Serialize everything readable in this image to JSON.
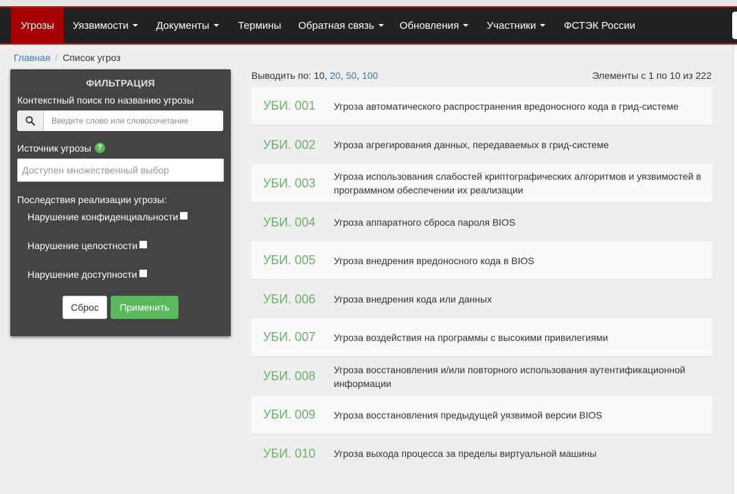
{
  "nav": {
    "items": [
      {
        "label": "Угрозы",
        "dropdown": false,
        "active": true
      },
      {
        "label": "Уязвимости",
        "dropdown": true
      },
      {
        "label": "Документы",
        "dropdown": true
      },
      {
        "label": "Термины",
        "dropdown": false
      },
      {
        "label": "Обратная связь",
        "dropdown": true
      },
      {
        "label": "Обновления",
        "dropdown": true
      },
      {
        "label": "Участники",
        "dropdown": true
      },
      {
        "label": "ФСТЭК России",
        "dropdown": false
      }
    ],
    "colors": {
      "background": "#222222",
      "active": "#a40000",
      "accent_border": "#b51c1c"
    }
  },
  "breadcrumb": {
    "home": "Главная",
    "separator": "/",
    "current": "Список угроз"
  },
  "filter": {
    "title": "ФИЛЬТРАЦИЯ",
    "search_label": "Контекстный поиск по названию угрозы",
    "search_placeholder": "Введите слово или словосочетание",
    "search_icon": "search-icon",
    "source_label": "Источник угрозы",
    "source_help_icon": "?",
    "source_placeholder": "Доступен множественный выбор",
    "consequences_label": "Последствия реализации угрозы:",
    "checkboxes": [
      {
        "label": "Нарушение конфиденциальности",
        "checked": false
      },
      {
        "label": "Нарушение целостности",
        "checked": false
      },
      {
        "label": "Нарушение доступности",
        "checked": false
      }
    ],
    "reset_label": "Сброс",
    "apply_label": "Применить",
    "colors": {
      "panel": "#444444",
      "apply": "#5cb85c"
    }
  },
  "pagination": {
    "label": "Выводить по:",
    "current": "10",
    "options": [
      "20",
      "50",
      "100"
    ],
    "range_text": "Элементы с 1 по 10 из 222"
  },
  "threats": [
    {
      "code": "УБИ. 001",
      "name": "Угроза автоматического распространения вредоносного кода в грид-системе"
    },
    {
      "code": "УБИ. 002",
      "name": "Угроза агрегирования данных, передаваемых в грид-системе"
    },
    {
      "code": "УБИ. 003",
      "name": "Угроза использования слабостей криптографических алгоритмов и уязвимостей в программном обеспечении их реализации"
    },
    {
      "code": "УБИ. 004",
      "name": "Угроза аппаратного сброса пароля BIOS"
    },
    {
      "code": "УБИ. 005",
      "name": "Угроза внедрения вредоносного кода в BIOS"
    },
    {
      "code": "УБИ. 006",
      "name": "Угроза внедрения кода или данных"
    },
    {
      "code": "УБИ. 007",
      "name": "Угроза воздействия на программы с высокими привилегиями"
    },
    {
      "code": "УБИ. 008",
      "name": "Угроза восстановления и/или повторного использования аутентификационной информации"
    },
    {
      "code": "УБИ. 009",
      "name": "Угроза восстановления предыдущей уязвимой версии BIOS"
    },
    {
      "code": "УБИ. 010",
      "name": "Угроза выхода процесса за пределы виртуальной машины"
    }
  ],
  "colors": {
    "threat_code": "#6ab06a",
    "link": "#337ab7"
  }
}
